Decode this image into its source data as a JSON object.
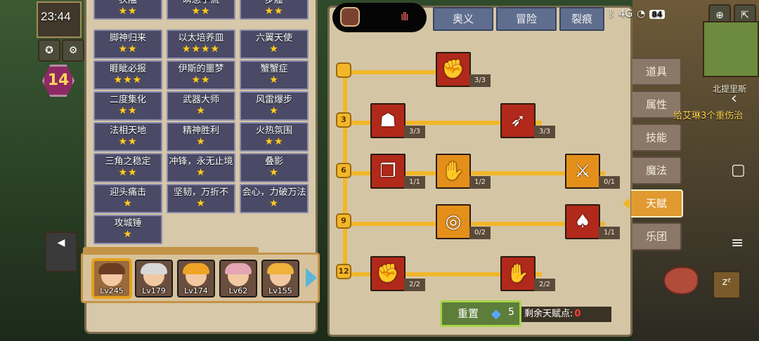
{
  "status_bar": {
    "time": "23:44",
    "battery": "84",
    "network": "4G"
  },
  "hud": {
    "level": "14",
    "map_label": "北提里斯",
    "quest_text": "给艾琳3个重伤治"
  },
  "skills": [
    {
      "name": "狭隘",
      "stars": "★★"
    },
    {
      "name": "瞬息子流",
      "stars": "★★"
    },
    {
      "name": "步履",
      "stars": "★★"
    },
    {
      "name": "脚神归来",
      "stars": "★★"
    },
    {
      "name": "以太培养皿",
      "stars": "★★★★"
    },
    {
      "name": "六翼天使",
      "stars": "★"
    },
    {
      "name": "睚眦必报",
      "stars": "★★★"
    },
    {
      "name": "伊斯的噩梦",
      "stars": "★★"
    },
    {
      "name": "蟹蟹症",
      "stars": "★"
    },
    {
      "name": "二度集化",
      "stars": "★★"
    },
    {
      "name": "武器大师",
      "stars": "★"
    },
    {
      "name": "风雷爆步",
      "stars": "★"
    },
    {
      "name": "法相天地",
      "stars": "★★"
    },
    {
      "name": "精神胜利",
      "stars": "★"
    },
    {
      "name": "火热氛围",
      "stars": "★★"
    },
    {
      "name": "三角之稳定",
      "stars": "★★"
    },
    {
      "name": "冲锋，永无止境",
      "stars": "★"
    },
    {
      "name": "叠影",
      "stars": "★"
    },
    {
      "name": "迎头痛击",
      "stars": "★"
    },
    {
      "name": "坚韧，万折不",
      "stars": "★"
    },
    {
      "name": "会心，力破万法",
      "stars": "★"
    },
    {
      "name": "攻城锤",
      "stars": "★"
    }
  ],
  "heroes": [
    {
      "level": "Lv245",
      "hair": "#6b3b22",
      "selected": true
    },
    {
      "level": "Lv179",
      "hair": "#d8d8d8",
      "selected": false
    },
    {
      "level": "Lv174",
      "hair": "#f0a326",
      "selected": false
    },
    {
      "level": "Lv62",
      "hair": "#e4a6b5",
      "selected": false
    },
    {
      "level": "Lv155",
      "hair": "#f0b23c",
      "selected": false
    }
  ],
  "top_tabs": [
    "奥义",
    "冒险",
    "裂痕"
  ],
  "side_tabs": [
    "道具",
    "属性",
    "技能",
    "魔法",
    "天赋",
    "乐团"
  ],
  "active_side_tab": "天赋",
  "tiers": [
    "3",
    "6",
    "9",
    "12"
  ],
  "talents": [
    {
      "icon": "arm-wrestle-icon",
      "glyph": "✊",
      "count": "3/3",
      "color": "red"
    },
    {
      "icon": "muscle-icon",
      "glyph": "☗",
      "count": "3/3",
      "color": "red"
    },
    {
      "icon": "arrow-hit-icon",
      "glyph": "➶",
      "count": "3/3",
      "color": "red"
    },
    {
      "icon": "card-swap-icon",
      "glyph": "❐",
      "count": "1/1",
      "color": "red"
    },
    {
      "icon": "fist-strike-icon",
      "glyph": "✋",
      "count": "1/2",
      "color": "orange"
    },
    {
      "icon": "sword-slash-icon",
      "glyph": "⚔",
      "count": "0/1",
      "color": "orange"
    },
    {
      "icon": "ripple-icon",
      "glyph": "◎",
      "count": "0/2",
      "color": "orange"
    },
    {
      "icon": "bat-wings-icon",
      "glyph": "♠",
      "count": "1/1",
      "color": "red"
    },
    {
      "icon": "raised-fist-icon",
      "glyph": "✊",
      "count": "2/2",
      "color": "red"
    },
    {
      "icon": "palm-icon",
      "glyph": "✋",
      "count": "2/2",
      "color": "red"
    }
  ],
  "reset": {
    "label": "重置",
    "cost": "5"
  },
  "remaining": {
    "label": "剩余天赋点:",
    "value": "0"
  }
}
